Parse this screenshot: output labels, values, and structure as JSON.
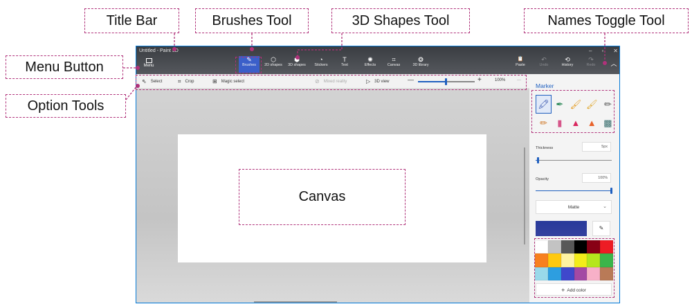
{
  "window": {
    "title": "Untitled - Paint 3D",
    "controls": [
      "–",
      "▫",
      "✕"
    ]
  },
  "menu": {
    "label": "Menu"
  },
  "toolbar": {
    "tools": [
      {
        "id": "brushes",
        "label": "Brushes",
        "icon": "brush-icon",
        "glyph": "✎"
      },
      {
        "id": "2d-shapes",
        "label": "2D shapes",
        "icon": "shapes-2d-icon",
        "glyph": "⬡"
      },
      {
        "id": "3d-shapes",
        "label": "3D shapes",
        "icon": "cube-icon",
        "glyph": "⬢"
      },
      {
        "id": "stickers",
        "label": "Stickers",
        "icon": "sticker-icon",
        "glyph": "◔"
      },
      {
        "id": "text",
        "label": "Text",
        "icon": "text-icon",
        "glyph": "T"
      },
      {
        "id": "effects",
        "label": "Effects",
        "icon": "effects-icon",
        "glyph": "✺"
      },
      {
        "id": "canvas",
        "label": "Canvas",
        "icon": "canvas-icon",
        "glyph": "⌗"
      },
      {
        "id": "3d-library",
        "label": "3D library",
        "icon": "library-icon",
        "glyph": "❂"
      }
    ],
    "right_tools": [
      {
        "id": "paste",
        "label": "Paste",
        "icon": "paste-icon",
        "glyph": "📋",
        "enabled": true
      },
      {
        "id": "undo",
        "label": "Undo",
        "icon": "undo-icon",
        "glyph": "↶",
        "enabled": false
      },
      {
        "id": "history",
        "label": "History",
        "icon": "history-icon",
        "glyph": "⟲",
        "enabled": true
      },
      {
        "id": "redo",
        "label": "Redo",
        "icon": "redo-icon",
        "glyph": "↷",
        "enabled": false
      }
    ],
    "collapse_glyph": "︿"
  },
  "options": {
    "select": "Select",
    "crop": "Crop",
    "magic_select": "Magic select",
    "mixed_reality": "Mixed reality",
    "view_3d": "3D view",
    "zoom_minus": "—",
    "zoom_plus": "+",
    "zoom_value": "100%",
    "more": "···",
    "zoom_fraction": 0.5
  },
  "panel": {
    "title": "Marker",
    "brushes": [
      {
        "name": "marker",
        "glyph": "🖍",
        "color": "#2b4aa8",
        "selected": true
      },
      {
        "name": "calligraphy-pen",
        "glyph": "✒",
        "color": "#2f8a5a"
      },
      {
        "name": "oil-brush",
        "glyph": "🖌",
        "color": "#e59b21"
      },
      {
        "name": "watercolor",
        "glyph": "🖌",
        "color": "#e0a830"
      },
      {
        "name": "pixel-pen",
        "glyph": "✏",
        "color": "#555555"
      },
      {
        "name": "pencil",
        "glyph": "✏",
        "color": "#d0792a"
      },
      {
        "name": "eraser",
        "glyph": "▮",
        "color": "#d6568a"
      },
      {
        "name": "crayon",
        "glyph": "▲",
        "color": "#d9275e"
      },
      {
        "name": "spray-can",
        "glyph": "▲",
        "color": "#e8612a"
      },
      {
        "name": "fill",
        "glyph": "▩",
        "color": "#3a6f6f"
      }
    ],
    "thickness": {
      "label": "Thickness",
      "value": "5px",
      "fraction": 0.04
    },
    "opacity": {
      "label": "Opacity",
      "value": "100%",
      "fraction": 1.0
    },
    "finish": {
      "value": "Matte",
      "chevron": "⌄"
    },
    "current_color": "#34419f",
    "palette": [
      "#ffffff",
      "#c3c3c3",
      "#585858",
      "#000000",
      "#880015",
      "#ed1c24",
      "#f7801f",
      "#ffc90e",
      "#fff3a1",
      "#f4ec1a",
      "#b5e61d",
      "#3ab54a",
      "#99d9ea",
      "#2d9ee0",
      "#3f48cc",
      "#a349a4",
      "#f7b0c8",
      "#b97a57"
    ],
    "add_color": "Add color"
  },
  "callouts": {
    "title_bar": "Title Bar",
    "brushes_tool": "Brushes Tool",
    "shapes_3d_tool": "3D Shapes Tool",
    "names_toggle_tool": "Names Toggle Tool",
    "menu_button": "Menu Button",
    "option_tools": "Option Tools",
    "canvas": "Canvas"
  },
  "colors": {
    "accent": "#1f5fbf",
    "callout_border": "#b0327a"
  }
}
